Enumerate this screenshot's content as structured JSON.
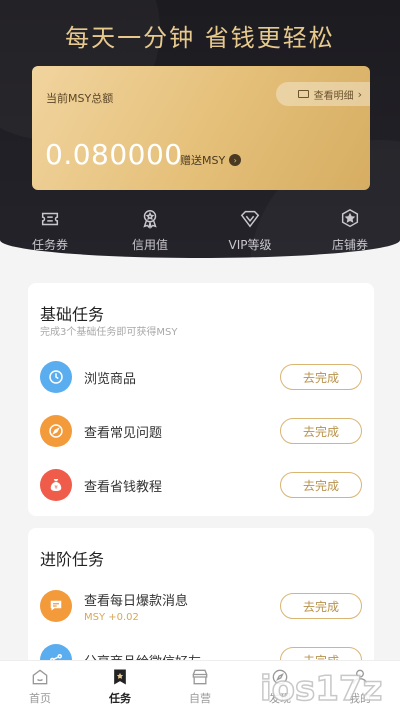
{
  "header": {
    "slogan": "每天一分钟 省钱更轻松"
  },
  "balance": {
    "label": "当前MSY总额",
    "detail_label": "查看明细",
    "amount": "0.080000",
    "gift_label": "赠送MSY"
  },
  "quick": [
    {
      "label": "任务券",
      "icon": "ticket-icon"
    },
    {
      "label": "信用值",
      "icon": "award-icon"
    },
    {
      "label": "VIP等级",
      "icon": "diamond-icon"
    },
    {
      "label": "店铺券",
      "icon": "shop-coupon-icon"
    }
  ],
  "basic": {
    "title": "基础任务",
    "subtitle": "完成3个基础任务即可获得MSY",
    "tasks": [
      {
        "name": "浏览商品",
        "button": "去完成",
        "icon": "clock-icon",
        "color": "#5aaef0"
      },
      {
        "name": "查看常见问题",
        "button": "去完成",
        "icon": "compass-icon",
        "color": "#f39a3a"
      },
      {
        "name": "查看省钱教程",
        "button": "去完成",
        "icon": "money-bag-icon",
        "color": "#ef5c4a"
      }
    ]
  },
  "advanced": {
    "title": "进阶任务",
    "tasks": [
      {
        "name": "查看每日爆款消息",
        "reward": "MSY +0.02",
        "button": "去完成",
        "icon": "message-icon",
        "color": "#f39a3a"
      },
      {
        "name": "分享商品给微信好友",
        "button": "去完成",
        "icon": "share-icon",
        "color": "#5aaef0"
      }
    ]
  },
  "nav": [
    {
      "label": "首页",
      "icon": "home-icon"
    },
    {
      "label": "任务",
      "icon": "task-icon",
      "active": true
    },
    {
      "label": "自营",
      "icon": "store-icon"
    },
    {
      "label": "发现",
      "icon": "discover-icon"
    },
    {
      "label": "我的",
      "icon": "profile-icon"
    }
  ],
  "watermark": {
    "text": "ios17z"
  },
  "colors": {
    "gold": "#e7c98e",
    "header_bg": "#1c1b20",
    "button_border": "#d9b574"
  }
}
